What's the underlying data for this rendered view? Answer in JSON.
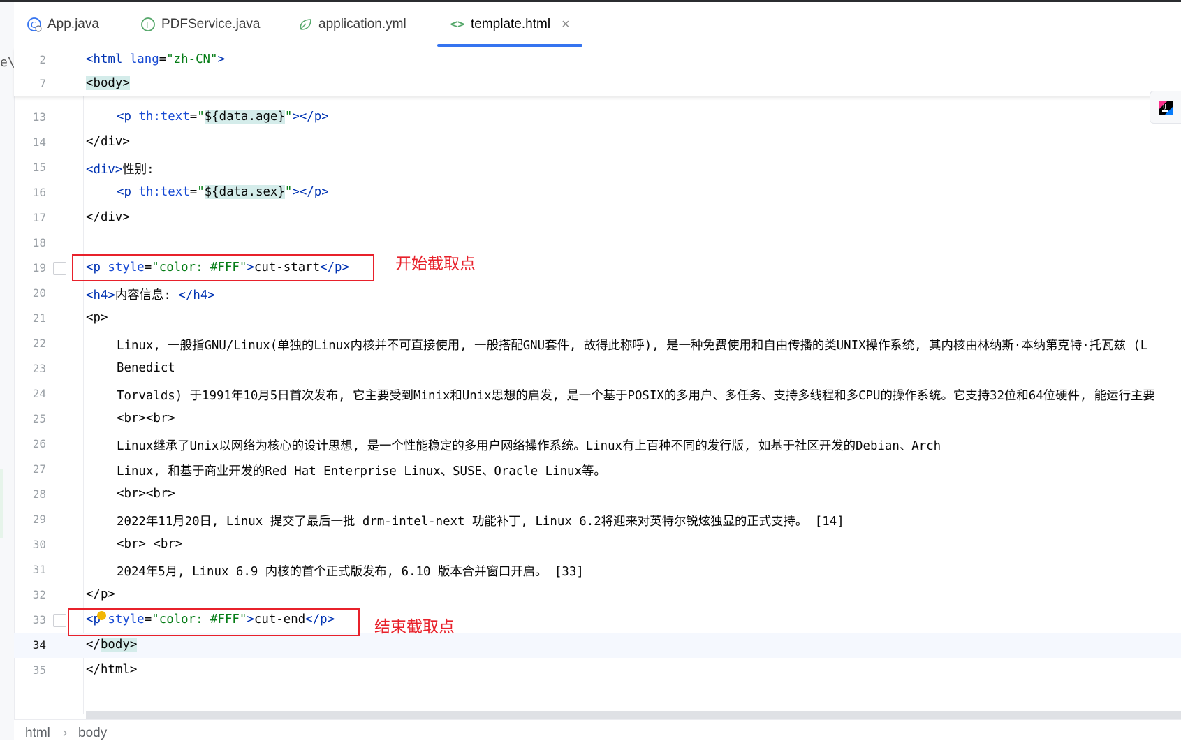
{
  "left_fragment": "e\\r",
  "tabs": [
    {
      "label": "App.java",
      "icon": "java-class-icon"
    },
    {
      "label": "PDFService.java",
      "icon": "interface-icon"
    },
    {
      "label": "application.yml",
      "icon": "yaml-leaf-icon"
    },
    {
      "label": "template.html",
      "icon": "html-icon",
      "active": true
    }
  ],
  "sticky_lines": [
    {
      "ln": "2",
      "tag_open": "<html ",
      "attr": "lang",
      "eq": "=",
      "val": "\"zh-CN\"",
      "tag_close": ">"
    },
    {
      "ln": "7",
      "text": "<body>"
    }
  ],
  "lines": {
    "13": {
      "ln": "13",
      "a": "<p ",
      "b": "th:text",
      "c": "=",
      "d": "\"",
      "e": "${data.age}",
      "f": "\"",
      "g": "></p>"
    },
    "14": {
      "ln": "14",
      "a": "</div>"
    },
    "15": {
      "ln": "15",
      "a": "<div>",
      "b": "性别:"
    },
    "16": {
      "ln": "16",
      "a": "<p ",
      "b": "th:text",
      "c": "=",
      "d": "\"",
      "e": "${data.sex}",
      "f": "\"",
      "g": "></p>"
    },
    "17": {
      "ln": "17",
      "a": "</div>"
    },
    "18": {
      "ln": "18"
    },
    "19": {
      "ln": "19",
      "a": "<p ",
      "b": "style",
      "c": "=",
      "d": "\"color: #FFF\"",
      "e": ">",
      "f": "cut-start",
      "g": "</p>"
    },
    "20": {
      "ln": "20",
      "a": "<h4>",
      "b": "内容信息: ",
      "c": "</h4>"
    },
    "21": {
      "ln": "21",
      "a": "<p>"
    },
    "22": {
      "ln": "22",
      "text": "Linux, 一般指GNU/Linux(单独的Linux内核并不可直接使用, 一般搭配GNU套件, 故得此称呼), 是一种免费使用和自由传播的类UNIX操作系统, 其内核由林纳斯·本纳第克特·托瓦兹 (L"
    },
    "23": {
      "ln": "23",
      "text": "Benedict"
    },
    "24": {
      "ln": "24",
      "text": "Torvalds) 于1991年10月5日首次发布, 它主要受到Minix和Unix思想的启发, 是一个基于POSIX的多用户、多任务、支持多线程和多CPU的操作系统。它支持32位和64位硬件, 能运行主要"
    },
    "25": {
      "ln": "25",
      "a": "<br><br>"
    },
    "26": {
      "ln": "26",
      "text": "Linux继承了Unix以网络为核心的设计思想, 是一个性能稳定的多用户网络操作系统。Linux有上百种不同的发行版, 如基于社区开发的Debian、Arch"
    },
    "27": {
      "ln": "27",
      "text": "Linux, 和基于商业开发的Red Hat Enterprise Linux、SUSE、Oracle Linux等。"
    },
    "28": {
      "ln": "28",
      "a": "<br><br>"
    },
    "29": {
      "ln": "29",
      "text": "2022年11月20日, Linux 提交了最后一批 drm-intel-next 功能补丁, Linux 6.2将迎来对英特尔锐炫独显的正式支持。 [14]"
    },
    "30": {
      "ln": "30",
      "a": "<br> <br>"
    },
    "31": {
      "ln": "31",
      "text": "2024年5月, Linux 6.9 内核的首个正式版发布, 6.10 版本合并窗口开启。 [33]"
    },
    "32": {
      "ln": "32",
      "a": "</p>"
    },
    "33": {
      "ln": "33",
      "a": "<p ",
      "b": "style",
      "c": "=",
      "d": "\"color: #FFF\"",
      "e": ">",
      "f": "cut-end",
      "g": "</p>"
    },
    "34": {
      "ln": "34",
      "a": "</",
      "b": "body",
      "c": ">"
    },
    "35": {
      "ln": "35",
      "a": "</html>"
    }
  },
  "annotations": {
    "start": "开始截取点",
    "end": "结束截取点"
  },
  "breadcrumb": [
    "html",
    "body"
  ],
  "colors": {
    "tag": "#0033b3",
    "attr": "#174ad4",
    "string": "#067d17",
    "annotation": "#e8212b",
    "active_tab": "#3574f0"
  }
}
